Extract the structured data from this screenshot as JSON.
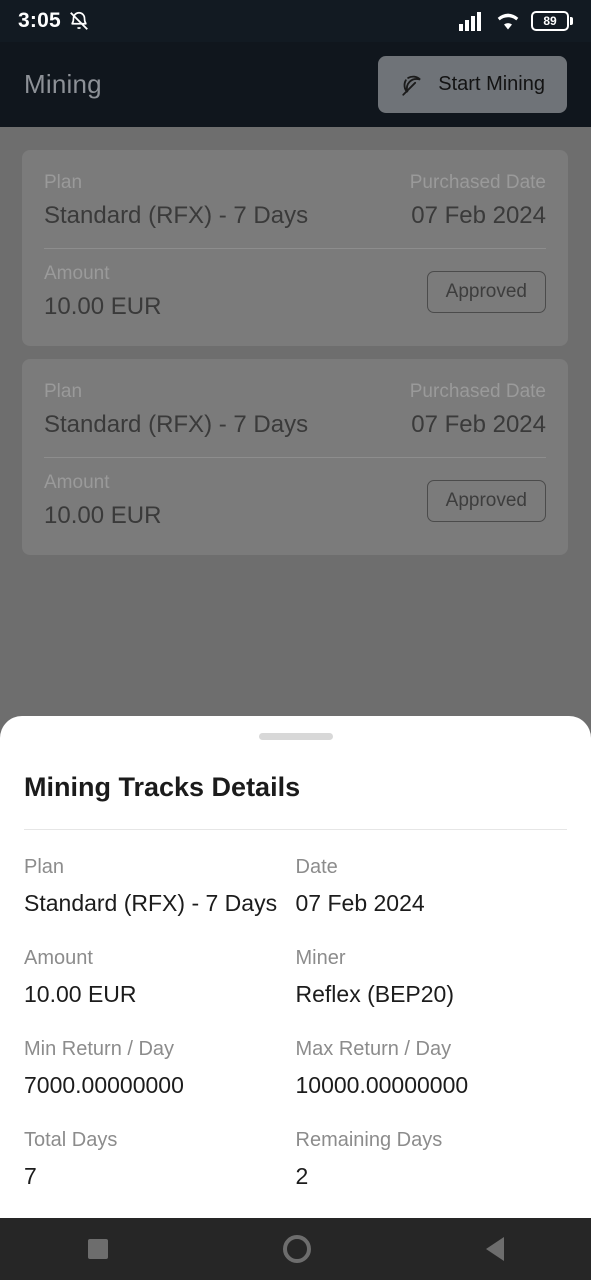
{
  "status_bar": {
    "time": "3:05",
    "mute_icon": "bell-muted-icon",
    "signal_icon": "cellular-signal-icon",
    "wifi_icon": "wifi-icon",
    "battery_level": "89"
  },
  "app_bar": {
    "title": "Mining",
    "start_button_label": "Start Mining",
    "start_button_icon": "pickaxe-icon",
    "start_button_color": "#6f7378"
  },
  "background_page": {
    "cards": [
      {
        "plan_label": "Plan",
        "plan_value": "Standard (RFX) - 7 Days",
        "date_label": "Purchased Date",
        "date_value": "07 Feb 2024",
        "amount_label": "Amount",
        "amount_value": "10.00 EUR",
        "status": "Approved"
      },
      {
        "plan_label": "Plan",
        "plan_value": "Standard (RFX) - 7 Days",
        "date_label": "Purchased Date",
        "date_value": "07 Feb 2024",
        "amount_label": "Amount",
        "amount_value": "10.00 EUR",
        "status": "Approved"
      }
    ]
  },
  "sheet": {
    "title": "Mining Tracks Details",
    "fields": [
      {
        "label": "Plan",
        "value": "Standard (RFX) - 7 Days"
      },
      {
        "label": "Date",
        "value": "07 Feb 2024"
      },
      {
        "label": "Amount",
        "value": "10.00 EUR"
      },
      {
        "label": "Miner",
        "value": "Reflex (BEP20)"
      },
      {
        "label": "Min Return / Day",
        "value": "7000.00000000"
      },
      {
        "label": "Max Return / Day",
        "value": "10000.00000000"
      },
      {
        "label": "Total Days",
        "value": "7"
      },
      {
        "label": "Remaining Days",
        "value": "2"
      }
    ]
  },
  "nav_bar": {
    "recent_icon": "square-recents-icon",
    "home_icon": "circle-home-icon",
    "back_icon": "triangle-back-icon"
  }
}
